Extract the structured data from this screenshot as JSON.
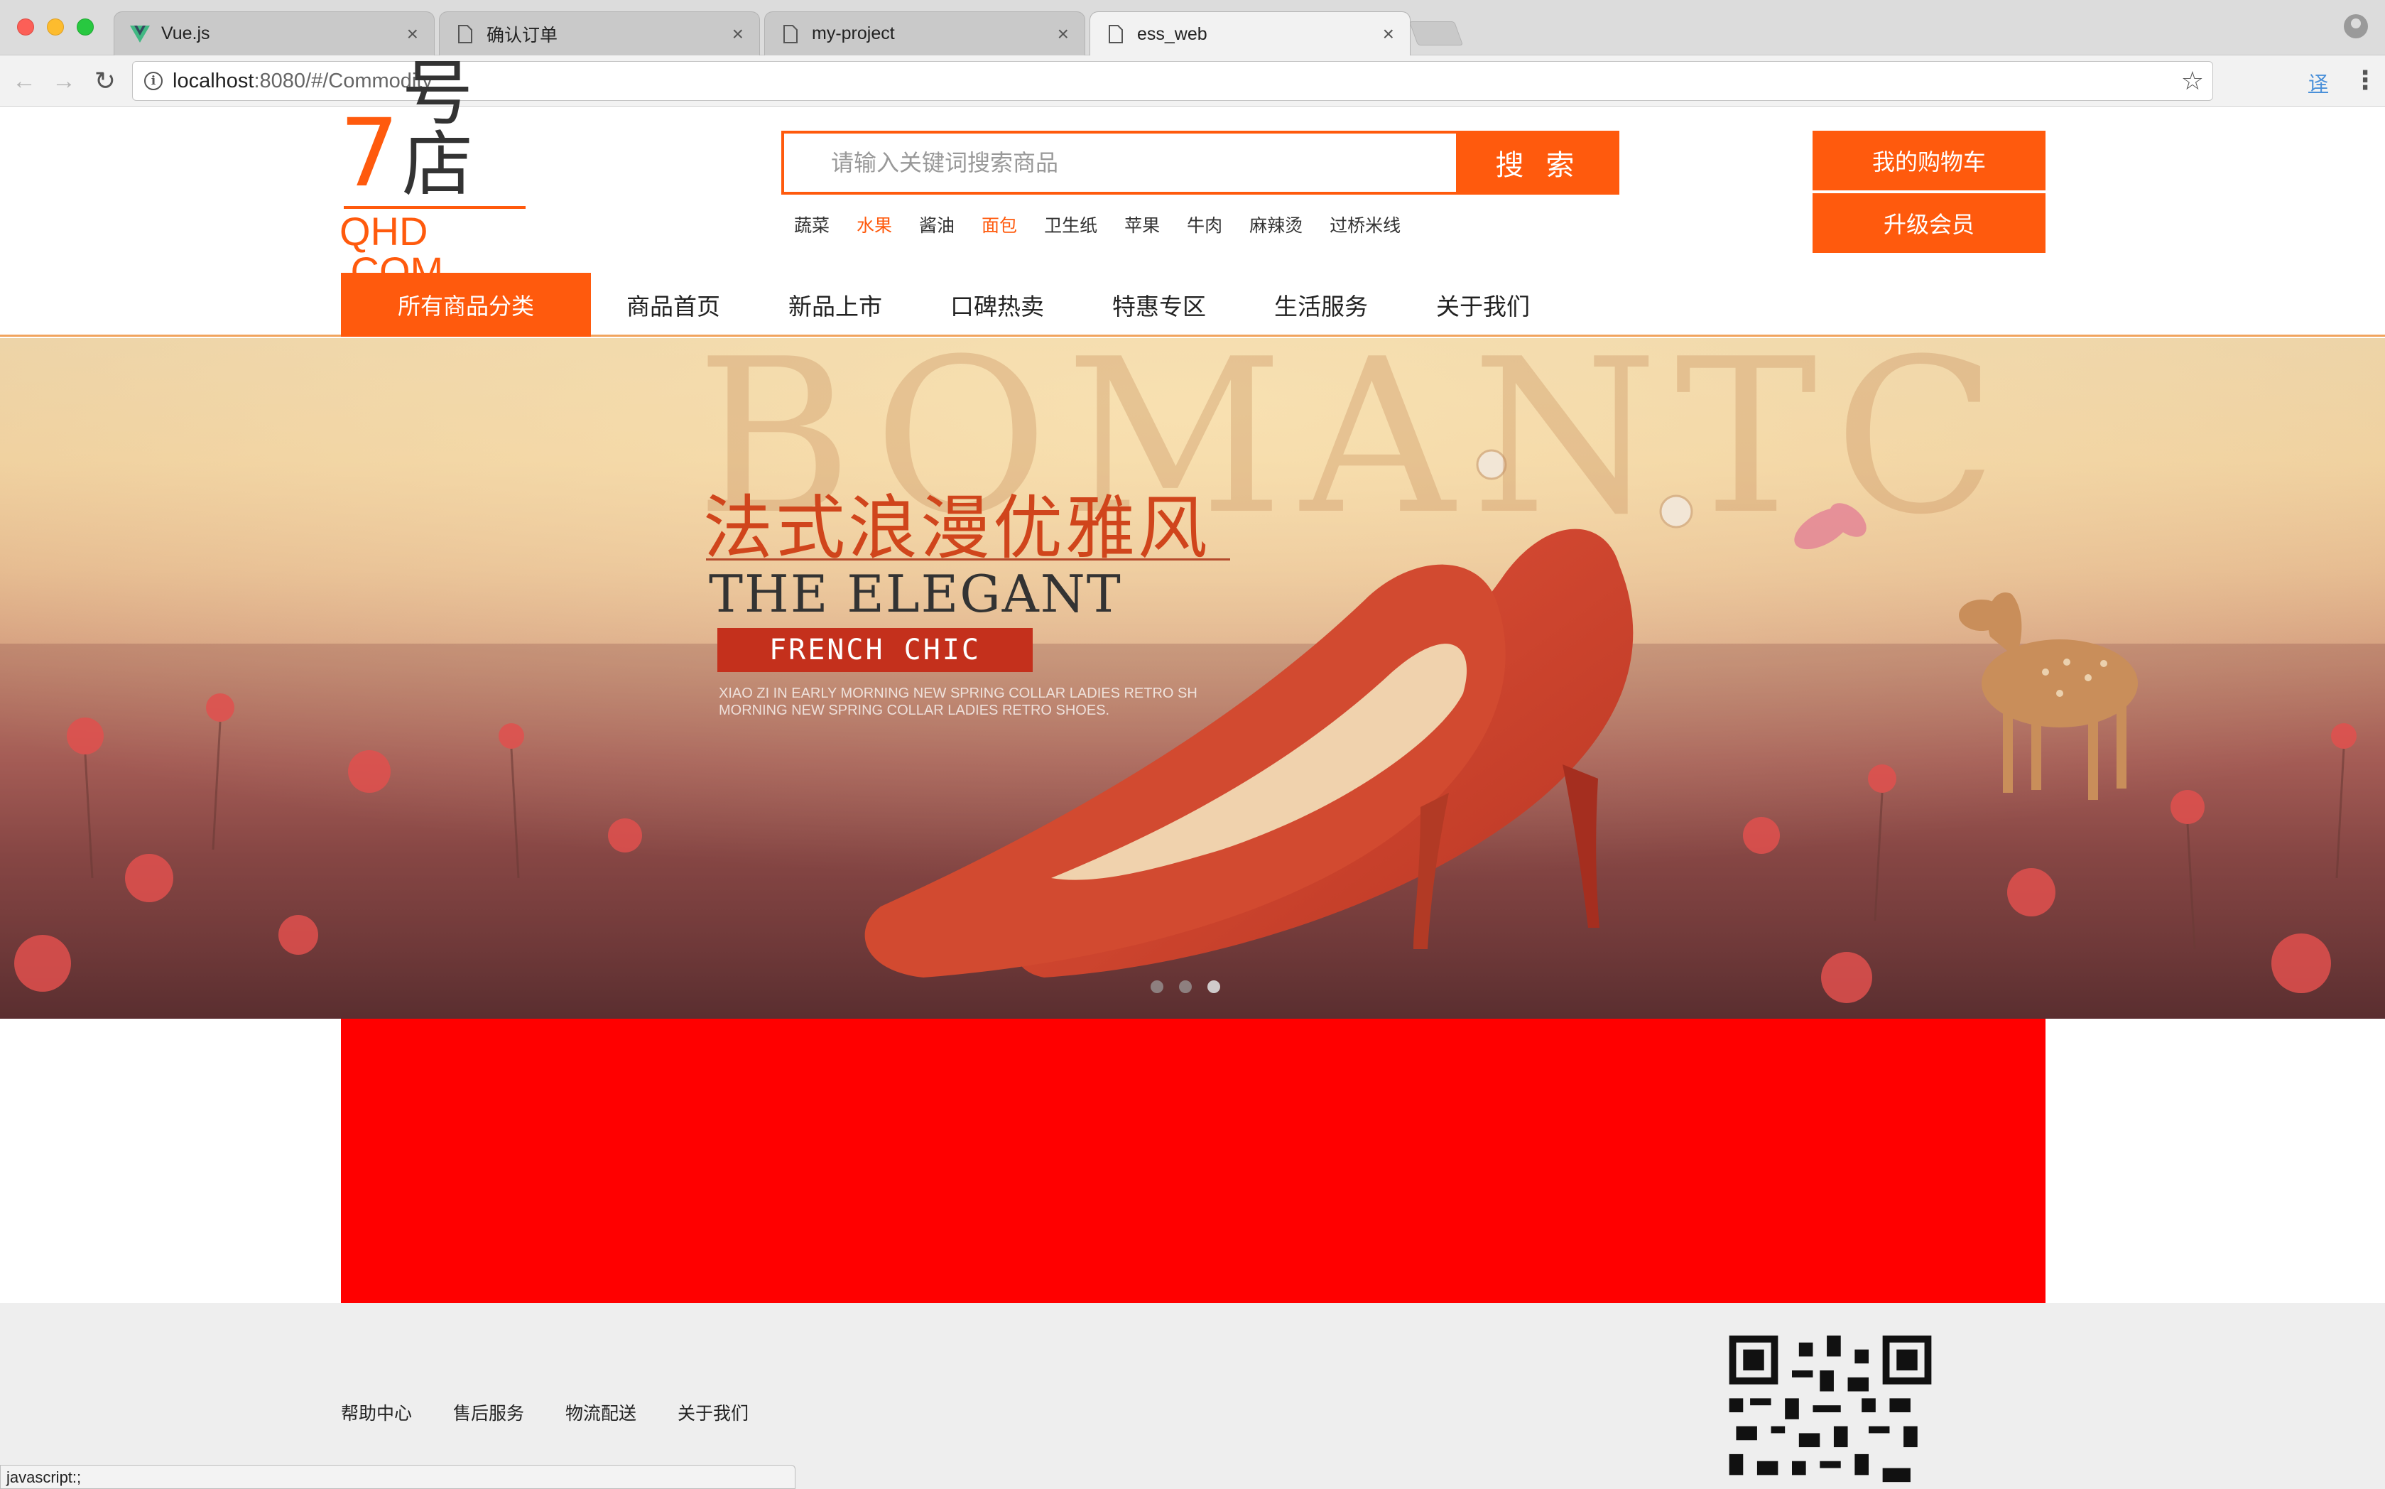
{
  "browser": {
    "tabs": [
      {
        "title": "Vue.js",
        "icon": "vue-logo-icon",
        "active": false
      },
      {
        "title": "确认订单",
        "icon": "page-icon",
        "active": false
      },
      {
        "title": "my-project",
        "icon": "page-icon",
        "active": false
      },
      {
        "title": "ess_web",
        "icon": "page-icon",
        "active": true
      }
    ],
    "url_host": "localhost",
    "url_path": ":8080/#/Commodity",
    "status_text": "javascript:;"
  },
  "header": {
    "logo": {
      "number": "7",
      "name": "号店",
      "domain": "QHD .COM"
    },
    "search": {
      "placeholder": "请输入关键词搜索商品",
      "button_label": "搜 索"
    },
    "hot_keywords": [
      {
        "label": "蔬菜",
        "highlight": false
      },
      {
        "label": "水果",
        "highlight": true
      },
      {
        "label": "酱油",
        "highlight": false
      },
      {
        "label": "面包",
        "highlight": true
      },
      {
        "label": "卫生纸",
        "highlight": false
      },
      {
        "label": "苹果",
        "highlight": false
      },
      {
        "label": "牛肉",
        "highlight": false
      },
      {
        "label": "麻辣烫",
        "highlight": false
      },
      {
        "label": "过桥米线",
        "highlight": false
      }
    ],
    "cart_label": "我的购物车",
    "vip_label": "升级会员"
  },
  "nav": {
    "all_categories": "所有商品分类",
    "items": [
      "商品首页",
      "新品上市",
      "口碑热卖",
      "特惠专区",
      "生活服务",
      "关于我们"
    ]
  },
  "banner": {
    "watermark": "BOMANTC",
    "title_cn": "法式浪漫优雅风",
    "title_en": "THE ELEGANT",
    "tag": "FRENCH CHIC",
    "small_line_1": "XIAO ZI IN EARLY MORNING NEW SPRING COLLAR LADIES RETRO SH",
    "small_line_2": "MORNING NEW SPRING COLLAR LADIES RETRO SHOES.",
    "slide_count": 3,
    "active_slide": 3
  },
  "footer": {
    "links": [
      "帮助中心",
      "售后服务",
      "物流配送",
      "关于我们"
    ]
  },
  "colors": {
    "accent": "#ff5a0d",
    "content_block": "#ff0000",
    "footer_bg": "#eeeeee"
  }
}
